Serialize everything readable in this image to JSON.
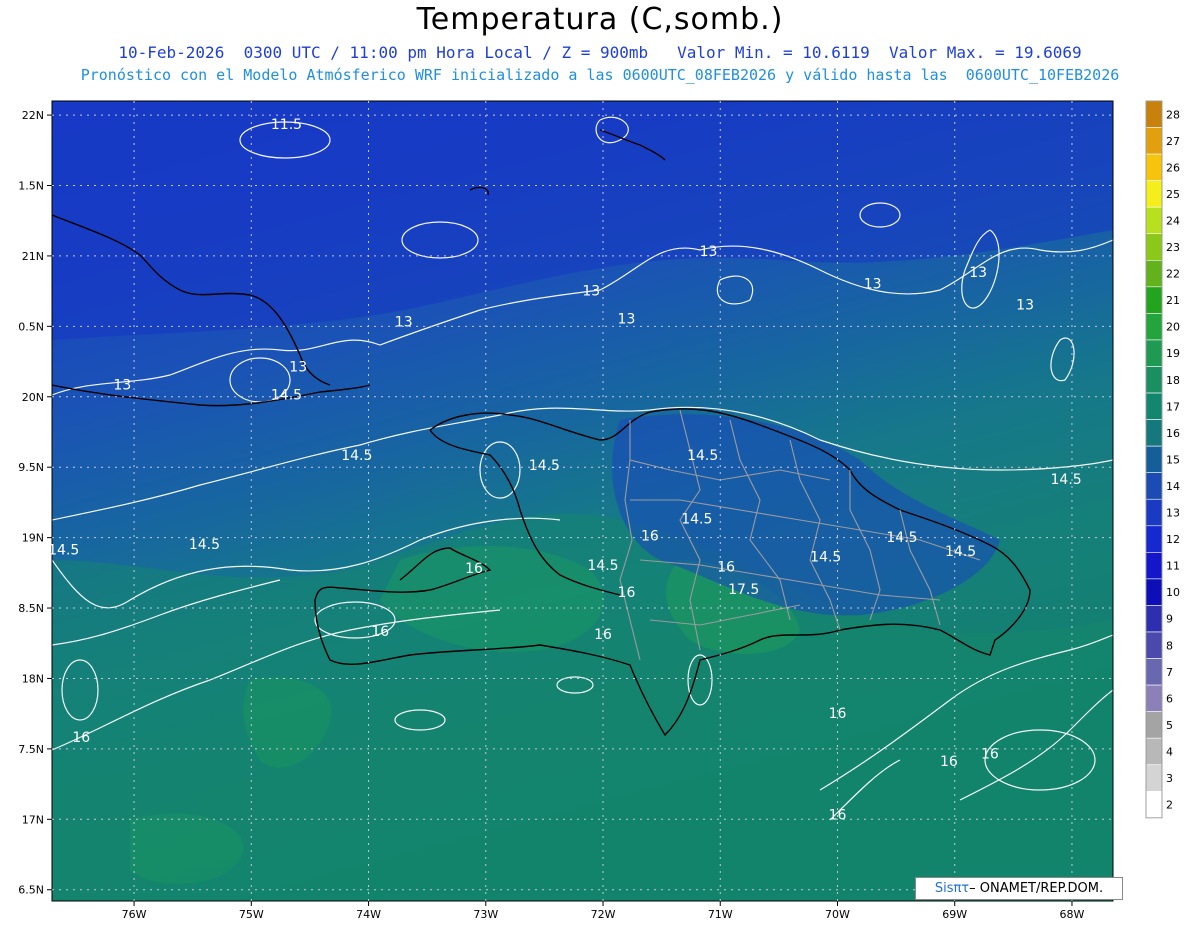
{
  "header": {
    "title": "Temperatura (C,somb.)",
    "line1": "10-Feb-2026  0300 UTC / 11:00 pm Hora Local / Z = 900mb   Valor Min. = 10.6119  Valor Max. = 19.6069",
    "line2": "Pronóstico con el Modelo Atmósferico WRF inicializado a las 0600UTC_08FEB2026 y válido hasta las  0600UTC_10FEB2026"
  },
  "credit": {
    "sis": "Sisπτ",
    "text": "– ONAMET/REP.DOM."
  },
  "map": {
    "lat_labels": [
      "22N",
      "1.5N",
      "21N",
      "0.5N",
      "20N",
      "9.5N",
      "19N",
      "8.5N",
      "18N",
      "7.5N",
      "17N",
      "6.5N"
    ],
    "lon_labels": [
      "76W",
      "75W",
      "74W",
      "73W",
      "72W",
      "71W",
      "70W",
      "69W",
      "68W"
    ],
    "contour_labels": [
      {
        "text": "11.5",
        "lon": -74.7,
        "lat": 21.9
      },
      {
        "text": "13",
        "lon": -71.1,
        "lat": 21.0
      },
      {
        "text": "13",
        "lon": -72.1,
        "lat": 20.72
      },
      {
        "text": "13",
        "lon": -71.8,
        "lat": 20.52
      },
      {
        "text": "13",
        "lon": -73.7,
        "lat": 20.5
      },
      {
        "text": "13",
        "lon": -69.7,
        "lat": 20.77
      },
      {
        "text": "13",
        "lon": -68.8,
        "lat": 20.85
      },
      {
        "text": "13",
        "lon": -68.4,
        "lat": 20.62
      },
      {
        "text": "13",
        "lon": -74.6,
        "lat": 20.18
      },
      {
        "text": "13",
        "lon": -76.1,
        "lat": 20.05
      },
      {
        "text": "14.5",
        "lon": -74.7,
        "lat": 19.98
      },
      {
        "text": "14.5",
        "lon": -74.1,
        "lat": 19.55
      },
      {
        "text": "14.5",
        "lon": -72.5,
        "lat": 19.48
      },
      {
        "text": "14.5",
        "lon": -71.15,
        "lat": 19.55
      },
      {
        "text": "14.5",
        "lon": -71.2,
        "lat": 19.1
      },
      {
        "text": "14.5",
        "lon": -70.1,
        "lat": 18.83
      },
      {
        "text": "14.5",
        "lon": -69.45,
        "lat": 18.97
      },
      {
        "text": "14.5",
        "lon": -68.95,
        "lat": 18.87
      },
      {
        "text": "14.5",
        "lon": -68.05,
        "lat": 19.38
      },
      {
        "text": "14.5",
        "lon": -75.4,
        "lat": 18.92
      },
      {
        "text": "14.5",
        "lon": -76.6,
        "lat": 18.88
      },
      {
        "text": "14.5",
        "lon": -72.0,
        "lat": 18.77
      },
      {
        "text": "16",
        "lon": -71.6,
        "lat": 18.98
      },
      {
        "text": "16",
        "lon": -73.1,
        "lat": 18.75
      },
      {
        "text": "16",
        "lon": -71.8,
        "lat": 18.58
      },
      {
        "text": "16",
        "lon": -70.95,
        "lat": 18.76
      },
      {
        "text": "16",
        "lon": -73.9,
        "lat": 18.3
      },
      {
        "text": "16",
        "lon": -72.0,
        "lat": 18.28
      },
      {
        "text": "16",
        "lon": -76.45,
        "lat": 17.55
      },
      {
        "text": "16",
        "lon": -70.0,
        "lat": 17.72
      },
      {
        "text": "16",
        "lon": -68.7,
        "lat": 17.43
      },
      {
        "text": "16",
        "lon": -69.05,
        "lat": 17.38
      },
      {
        "text": "16",
        "lon": -70.0,
        "lat": 17.0
      },
      {
        "text": "17.5",
        "lon": -70.8,
        "lat": 18.6
      }
    ]
  },
  "colorbar": {
    "labels": [
      "28",
      "27",
      "26",
      "25",
      "24",
      "23",
      "22",
      "21",
      "20",
      "19",
      "18",
      "17",
      "16",
      "15",
      "14",
      "13",
      "12",
      "11",
      "10",
      "9",
      "8",
      "7",
      "6",
      "5",
      "4",
      "3",
      "2"
    ],
    "colors": [
      "#c8820c",
      "#e2a00e",
      "#f6c40c",
      "#f4ee1a",
      "#b8e01c",
      "#8cc81a",
      "#62b21c",
      "#22a41c",
      "#24a43c",
      "#1e9a52",
      "#1a9062",
      "#12866e",
      "#14787c",
      "#145e9a",
      "#1a4cb4",
      "#1a3ac4",
      "#1628d0",
      "#1416cc",
      "#0e0eb8",
      "#2e2eb0",
      "#4a4aac",
      "#6868b0",
      "#8c80b8",
      "#a4a4a4",
      "#b8b8b8",
      "#d4d4d4",
      "#ffffff"
    ]
  }
}
